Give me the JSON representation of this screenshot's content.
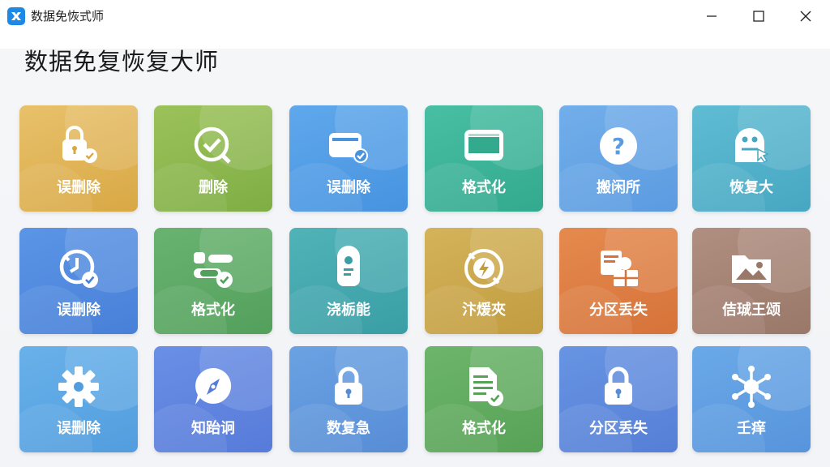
{
  "window": {
    "app_title": "数据免恢式师",
    "icons": {
      "app": "app-logo-icon",
      "minimize": "minimize-icon",
      "maximize": "maximize-icon",
      "close": "close-icon"
    }
  },
  "main": {
    "title": "数据免复恢复大师",
    "tiles": [
      {
        "label": "误删除",
        "icon": "lock-check-icon",
        "color_top": "#e8c16b",
        "color_bottom": "#d9a845"
      },
      {
        "label": "删除",
        "icon": "search-check-icon",
        "color_top": "#9cc25a",
        "color_bottom": "#7fae45"
      },
      {
        "label": "误删除",
        "icon": "folder-check-icon",
        "color_top": "#5fa8ec",
        "color_bottom": "#4793e0"
      },
      {
        "label": "格式化",
        "icon": "drive-icon",
        "color_top": "#48bfa3",
        "color_bottom": "#33a98e"
      },
      {
        "label": "搬闲所",
        "icon": "question-icon",
        "color_top": "#72aeea",
        "color_bottom": "#5b9be0"
      },
      {
        "label": "恢复大",
        "icon": "user-cursor-icon",
        "color_top": "#5fbcd3",
        "color_bottom": "#47a7c2"
      },
      {
        "label": "误删除",
        "icon": "clock-check-icon",
        "color_top": "#5b95e6",
        "color_bottom": "#4880d8"
      },
      {
        "label": "格式化",
        "icon": "toggle-check-icon",
        "color_top": "#68b36f",
        "color_bottom": "#53a05c"
      },
      {
        "label": "浇栃能",
        "icon": "usb-drive-icon",
        "color_top": "#4fb3b8",
        "color_bottom": "#3a9ea5"
      },
      {
        "label": "汴煖夾",
        "icon": "lightning-disc-icon",
        "color_top": "#d4b35a",
        "color_bottom": "#c29c40"
      },
      {
        "label": "分区丢失",
        "icon": "partition-icon",
        "color_top": "#e58a4e",
        "color_bottom": "#d6733a"
      },
      {
        "label": "佶珹王颂",
        "icon": "image-folder-icon",
        "color_top": "#b08e80",
        "color_bottom": "#9a7869"
      },
      {
        "label": "误删除",
        "icon": "gear-icon",
        "color_top": "#68b1ea",
        "color_bottom": "#529dde"
      },
      {
        "label": "知跆诇",
        "icon": "compass-icon",
        "color_top": "#6a8fe6",
        "color_bottom": "#577bd9"
      },
      {
        "label": "数复急",
        "icon": "padlock-icon",
        "color_top": "#6aa2e3",
        "color_bottom": "#588dd6"
      },
      {
        "label": "格式化",
        "icon": "document-check-icon",
        "color_top": "#6cb56a",
        "color_bottom": "#58a257"
      },
      {
        "label": "分区丢失",
        "icon": "padlock-icon",
        "color_top": "#6894e3",
        "color_bottom": "#557fd6"
      },
      {
        "label": "壬痒",
        "icon": "network-icon",
        "color_top": "#6aa9e8",
        "color_bottom": "#5794dc"
      }
    ]
  }
}
